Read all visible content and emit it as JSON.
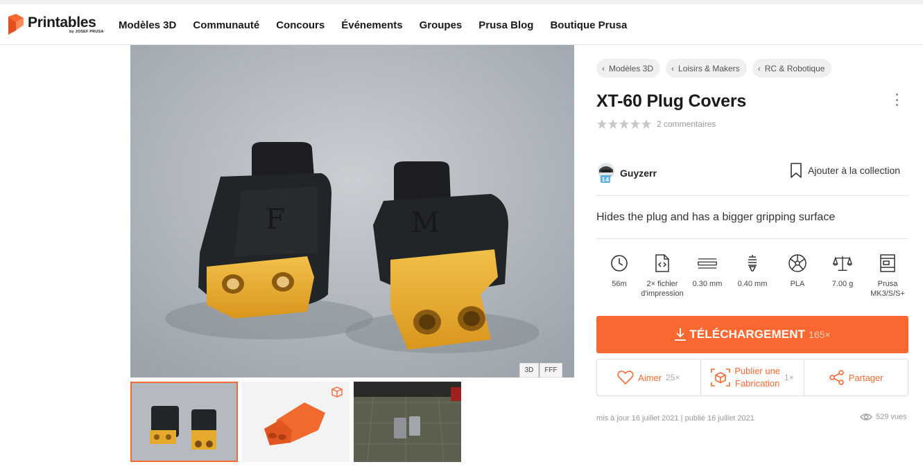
{
  "brand": {
    "name": "Printables",
    "sub": "by JOSEF PRUSA",
    "accent": "#fa6831"
  },
  "nav": [
    "Modèles 3D",
    "Communauté",
    "Concours",
    "Événements",
    "Groupes",
    "Prusa Blog",
    "Boutique Prusa"
  ],
  "gallery": {
    "view_3d": "3D",
    "view_fff": "FFF",
    "thumbnails": [
      "photo-plugs",
      "render-3d",
      "print-bed-photo"
    ]
  },
  "breadcrumbs": [
    "Modèles 3D",
    "Loisirs & Makers",
    "RC & Robotique"
  ],
  "model": {
    "title": "XT-60 Plug Covers",
    "rating": 0,
    "comments": "2 commentaires",
    "author": "Guyzerr",
    "author_level": "14",
    "add_to_collection": "Ajouter à la collection",
    "summary": "Hides the plug and has a bigger gripping surface"
  },
  "params": [
    {
      "icon": "clock-icon",
      "line1": "56m",
      "line2": ""
    },
    {
      "icon": "file-code-icon",
      "line1": "2× fichier",
      "line2": "d'impression"
    },
    {
      "icon": "layer-height-icon",
      "line1": "0.30 mm",
      "line2": ""
    },
    {
      "icon": "nozzle-icon",
      "line1": "0.40 mm",
      "line2": ""
    },
    {
      "icon": "filament-spool-icon",
      "line1": "PLA",
      "line2": ""
    },
    {
      "icon": "scale-icon",
      "line1": "7.00 g",
      "line2": ""
    },
    {
      "icon": "printer-icon",
      "line1": "Prusa",
      "line2": "MK3/S/S+"
    }
  ],
  "download": {
    "label": "TÉLÉCHARGEMENT",
    "count": "165×"
  },
  "actions": {
    "like_label": "Aimer",
    "like_count": "25×",
    "make_line1": "Publier une",
    "make_line2": "Fabrication",
    "make_count": "1×",
    "share_label": "Partager"
  },
  "meta": {
    "dates": "mis à jour 16 juillet 2021 | publié 16 juillet 2021",
    "views": "529 vues"
  }
}
